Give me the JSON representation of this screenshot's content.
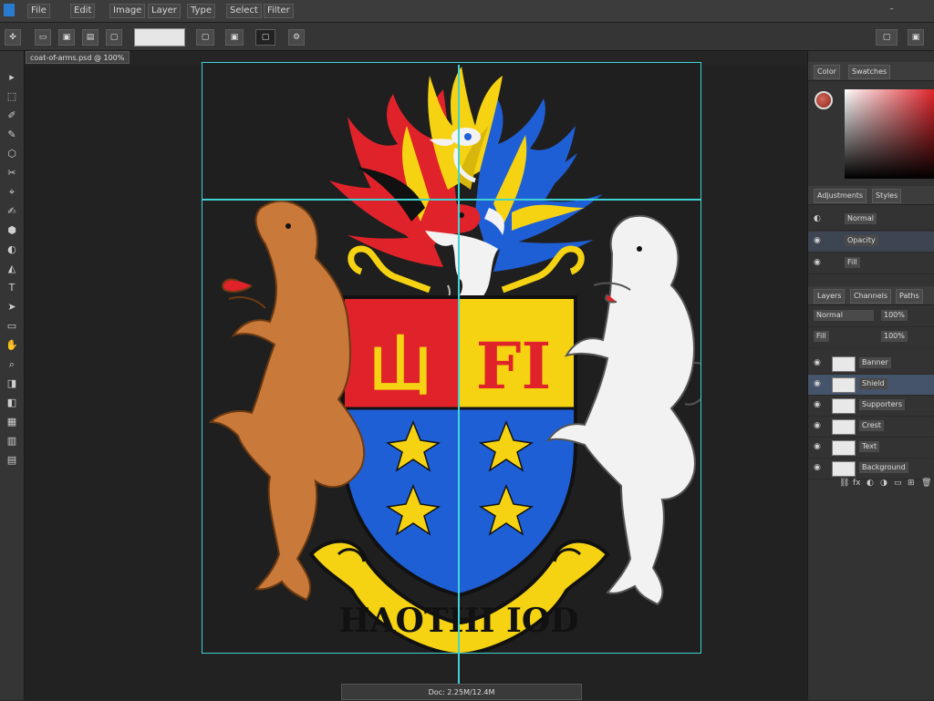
{
  "menu": {
    "items": [
      "File",
      "Edit",
      "Image",
      "Layer",
      "Type",
      "Select",
      "Filter"
    ]
  },
  "window_controls": {
    "minimize": "–"
  },
  "options_bar": {
    "buttons": [
      "▭",
      "▣",
      "▤",
      "▢"
    ],
    "input_value": "",
    "right_buttons": [
      "▢",
      "▣"
    ],
    "icon": "✜",
    "icon2": "⚙"
  },
  "tools": [
    "▸",
    "⬚",
    "✐",
    "✎",
    "⬡",
    "✂",
    "⌖",
    "✍",
    "⬢",
    "◐",
    "◭",
    "T",
    "➤",
    "▭",
    "✋",
    "⌕",
    "◨",
    "◧",
    "▦",
    "▥",
    "▤"
  ],
  "document": {
    "tab_label": "coat-of-arms.psd @ 100%",
    "zoom_status": "Doc: 2.25M/12.4M"
  },
  "panels": {
    "color": {
      "tabs": [
        "Color",
        "Swatches"
      ]
    },
    "adjustments": {
      "tabs": [
        "Adjustments",
        "Styles"
      ]
    },
    "layers": {
      "tabs": [
        "Layers",
        "Channels",
        "Paths"
      ],
      "blend_mode": "Normal",
      "opacity_label": "Opacity",
      "opacity": "100%",
      "fill_label": "Fill",
      "fill": "100%",
      "items": [
        {
          "name": "Banner"
        },
        {
          "name": "Shield"
        },
        {
          "name": "Supporters"
        },
        {
          "name": "Crest"
        },
        {
          "name": "Text"
        },
        {
          "name": "Background"
        }
      ],
      "footer_icons": [
        "⛓",
        "fx",
        "◐",
        "◑",
        "▭",
        "⊞",
        "🗑"
      ]
    }
  },
  "artwork": {
    "motto": "HAOTHI IOD",
    "shield_letters_left": "山",
    "shield_letters_right": "FI"
  },
  "colors": {
    "red": "#e0232a",
    "yellow": "#f5d312",
    "blue": "#1f5fd6",
    "brown": "#c9793a",
    "white": "#f2f2f2",
    "guide": "#3fd3d3"
  }
}
